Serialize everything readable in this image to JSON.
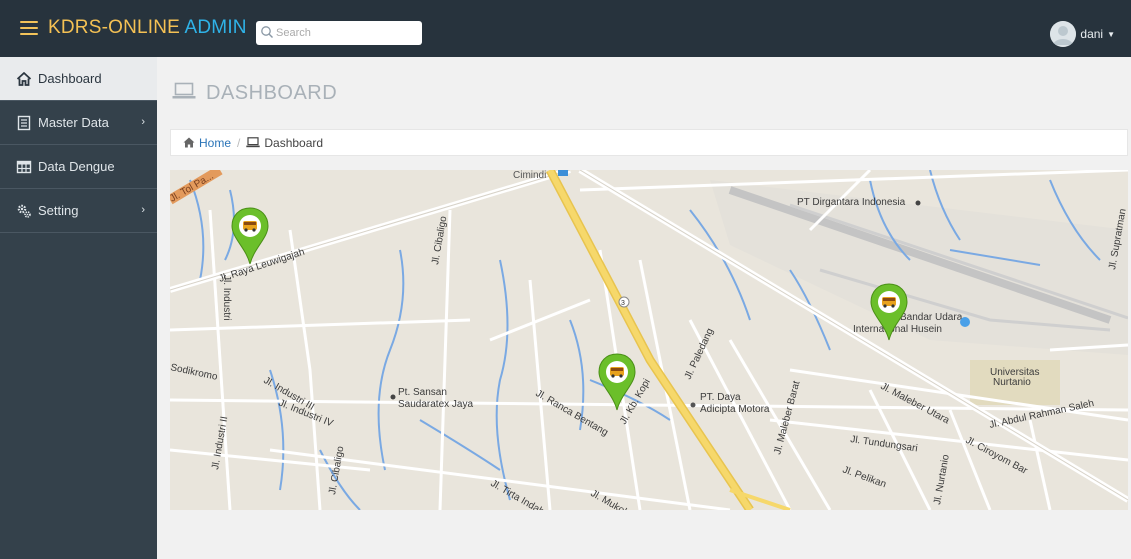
{
  "topbar": {
    "brand_part1": "KDRS-ONLINE",
    "brand_part2": " ADMIN",
    "search_placeholder": "Search",
    "username": "dani",
    "caret": "▼"
  },
  "sidebar": {
    "items": [
      {
        "label": "Dashboard",
        "icon": "home-icon",
        "active": true
      },
      {
        "label": "Master Data",
        "icon": "document-icon",
        "chevron": "›"
      },
      {
        "label": "Data Dengue",
        "icon": "table-icon"
      },
      {
        "label": "Setting",
        "icon": "gears-icon",
        "chevron": "›"
      }
    ]
  },
  "page": {
    "title": "DASHBOARD"
  },
  "breadcrumb": {
    "home": "Home",
    "separator": "/",
    "current": "Dashboard"
  },
  "map": {
    "labels": [
      "Cimindi",
      "Jl. Tol Pa...",
      "Jl. Raya Leuwigajah",
      "Jl. Cibaligo",
      "Jl. Industri",
      "PT Dirgantara Indonesia",
      "Bandar Udara",
      "International Husein",
      "Jl. Supratman",
      "Jl. Paledang",
      "PT. Daya",
      "Adicipta Motora",
      "Jl. Maleber Barat",
      "Jl. Maleber Utara",
      "Universitas",
      "Nurtanio",
      "Jl. Abdul Rahman Saleh",
      "Jl. Tundungsari",
      "Jl. Ciroyom Bar",
      "Jl. Pelikan",
      "Jl. Nurtanio",
      "Jl. Industri III",
      "Jl. Industri IV",
      "Pt. Sansan",
      "Saudaratex Jaya",
      "Jl. Ranca Bentang",
      "Jl. Kb. Kopi",
      "Jl. Industri II",
      "Jl. Cibaligo",
      "Jl. Tirta Indah",
      "Jl. Mukoh",
      "Sodikromo",
      "3"
    ],
    "markers": [
      {
        "name": "marker-1",
        "icon": "bus-marker-icon"
      },
      {
        "name": "marker-2",
        "icon": "bus-marker-icon"
      },
      {
        "name": "marker-3",
        "icon": "bus-marker-icon"
      }
    ],
    "colors": {
      "background": "#e9e5dc",
      "road": "#ffffff",
      "highway": "#f6d86b",
      "water": "#7aa9e3",
      "runway": "#c4c4c4",
      "marker": "#6bbf2a"
    }
  },
  "colors": {
    "topbar": "#27333d",
    "sidebar": "#34414b",
    "brand_yellow": "#f4c154",
    "brand_blue": "#2fb3e8",
    "link": "#2a74b8"
  }
}
